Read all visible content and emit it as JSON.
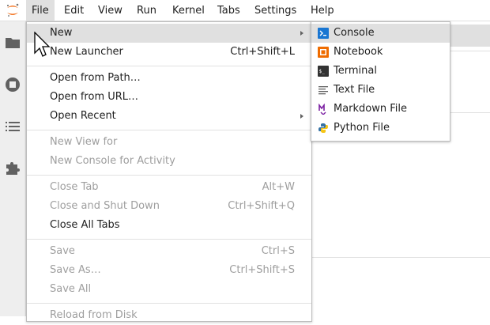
{
  "menubar": {
    "items": [
      "File",
      "Edit",
      "View",
      "Run",
      "Kernel",
      "Tabs",
      "Settings",
      "Help"
    ],
    "active": "File"
  },
  "file_menu": {
    "items": [
      {
        "label": "New",
        "submenu": true,
        "hover": true
      },
      {
        "label": "New Launcher",
        "shortcut": "Ctrl+Shift+L"
      },
      {
        "label": "Open from Path…"
      },
      {
        "label": "Open from URL…"
      },
      {
        "label": "Open Recent",
        "submenu": true
      },
      {
        "label": "New View for",
        "disabled": true
      },
      {
        "label": "New Console for Activity",
        "disabled": true
      },
      {
        "label": "Close Tab",
        "shortcut": "Alt+W",
        "disabled": true
      },
      {
        "label": "Close and Shut Down",
        "shortcut": "Ctrl+Shift+Q",
        "disabled": true
      },
      {
        "label": "Close All Tabs"
      },
      {
        "label": "Save",
        "shortcut": "Ctrl+S",
        "disabled": true
      },
      {
        "label": "Save As…",
        "shortcut": "Ctrl+Shift+S",
        "disabled": true
      },
      {
        "label": "Save All",
        "disabled": true
      },
      {
        "label": "Reload from Disk",
        "disabled": true
      }
    ]
  },
  "new_submenu": {
    "items": [
      {
        "label": "Console",
        "icon": "console-icon",
        "hover": true
      },
      {
        "label": "Notebook",
        "icon": "notebook-icon"
      },
      {
        "label": "Terminal",
        "icon": "terminal-icon"
      },
      {
        "label": "Text File",
        "icon": "text-file-icon"
      },
      {
        "label": "Markdown File",
        "icon": "markdown-file-icon"
      },
      {
        "label": "Python File",
        "icon": "python-file-icon"
      }
    ]
  },
  "sidebar": {
    "icons": [
      "folder-icon",
      "running-stop-icon",
      "table-of-contents-icon",
      "extension-puzzle-icon"
    ]
  },
  "colors": {
    "hover": "#e0e0e0",
    "disabled_text": "#9e9e9e",
    "console_icon": "#1976d2",
    "notebook_icon": "#ef6c00",
    "markdown_icon": "#7b1fa2",
    "logo": "#f37726"
  }
}
